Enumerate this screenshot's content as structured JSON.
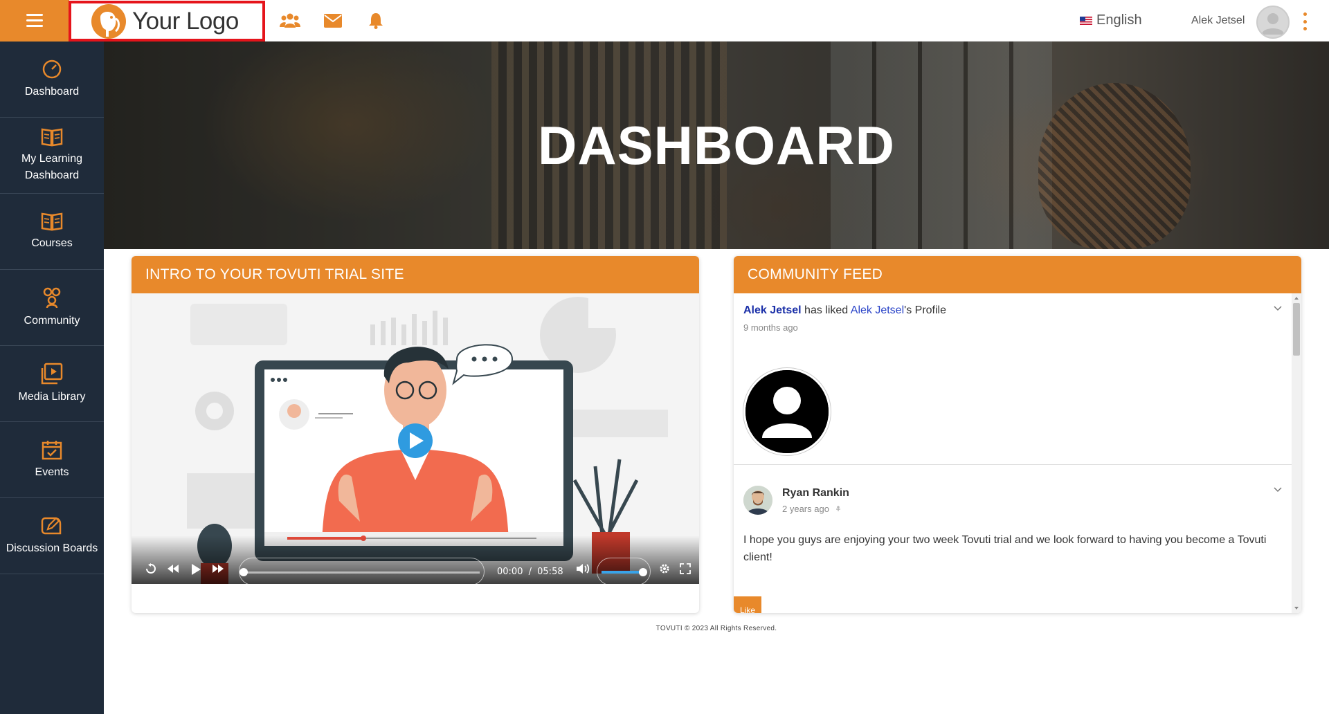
{
  "header": {
    "logo_text": "Your Logo",
    "language": "English",
    "user_name": "Alek Jetsel",
    "accent_color": "#e8892b",
    "icons": [
      "menu-icon",
      "community-icon",
      "mail-icon",
      "bell-icon",
      "us-flag-icon",
      "kebab-icon"
    ]
  },
  "sidebar": {
    "items": [
      {
        "label": "Dashboard",
        "icon": "dashboard-gauge-icon"
      },
      {
        "label": "My Learning Dashboard",
        "icon": "open-book-icon"
      },
      {
        "label": "Courses",
        "icon": "book-icon"
      },
      {
        "label": "Community",
        "icon": "people-icon"
      },
      {
        "label": "Media Library",
        "icon": "media-library-icon"
      },
      {
        "label": "Events",
        "icon": "calendar-icon"
      },
      {
        "label": "Discussion Boards",
        "icon": "discussion-edit-icon"
      }
    ]
  },
  "hero": {
    "title": "DASHBOARD"
  },
  "intro": {
    "title": "INTRO TO YOUR TOVUTI TRIAL SITE",
    "video": {
      "current_time": "00:00",
      "separator": "/",
      "duration": "05:58",
      "progress": 0,
      "volume": 1.0
    }
  },
  "feed": {
    "title": "COMMUNITY FEED",
    "item1": {
      "actor": "Alek Jetsel",
      "action": " has liked ",
      "target": "Alek Jetsel",
      "suffix": "'s Profile",
      "time": "9 months ago"
    },
    "item2": {
      "author": "Ryan Rankin",
      "time": "2 years ago",
      "message": "I hope you guys are enjoying your two week Tovuti trial and we look forward to having you become a Tovuti client!",
      "like_label": "Like"
    }
  },
  "footer": {
    "text": "TOVUTI © 2023 All Rights Reserved."
  }
}
